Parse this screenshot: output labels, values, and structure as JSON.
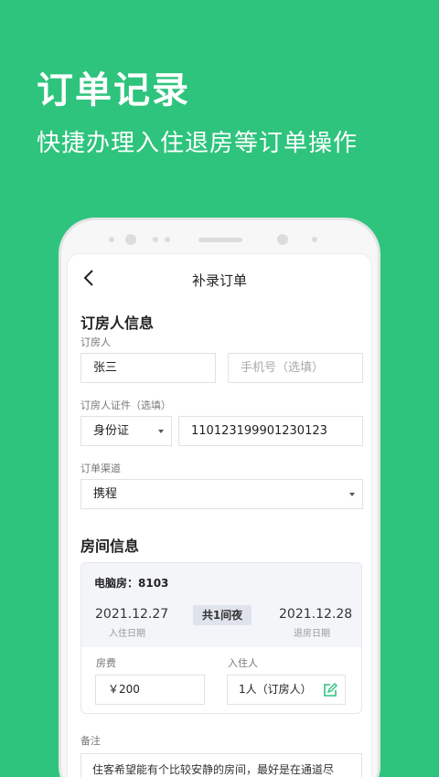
{
  "hero": {
    "title": "订单记录",
    "subtitle": "快捷办理入住退房等订单操作"
  },
  "nav": {
    "title": "补录订单",
    "back_icon": "chevron-left-icon"
  },
  "booker": {
    "section_title": "订房人信息",
    "name_label": "订房人",
    "name_value": "张三",
    "phone_placeholder": "手机号（选填）",
    "id_label": "订房人证件（选填）",
    "id_type": "身份证",
    "id_number": "110123199901230123",
    "channel_label": "订单渠道",
    "channel_value": "携程"
  },
  "room": {
    "section_title": "房间信息",
    "room_name": "电脑房：8103",
    "checkin_date": "2021.12.27",
    "checkin_label": "入住日期",
    "nights": "共1间夜",
    "checkout_date": "2021.12.28",
    "checkout_label": "退房日期",
    "price_label": "房费",
    "price_value": "￥200",
    "guest_label": "入住人",
    "guest_value": "1人（订房人）",
    "edit_icon": "edit-icon"
  },
  "remark": {
    "label": "备注",
    "text": "住客希望能有个比较安静的房间，最好是在通道尽"
  },
  "colors": {
    "brand": "#2ec47d",
    "card_header": "#f3f5f9"
  }
}
